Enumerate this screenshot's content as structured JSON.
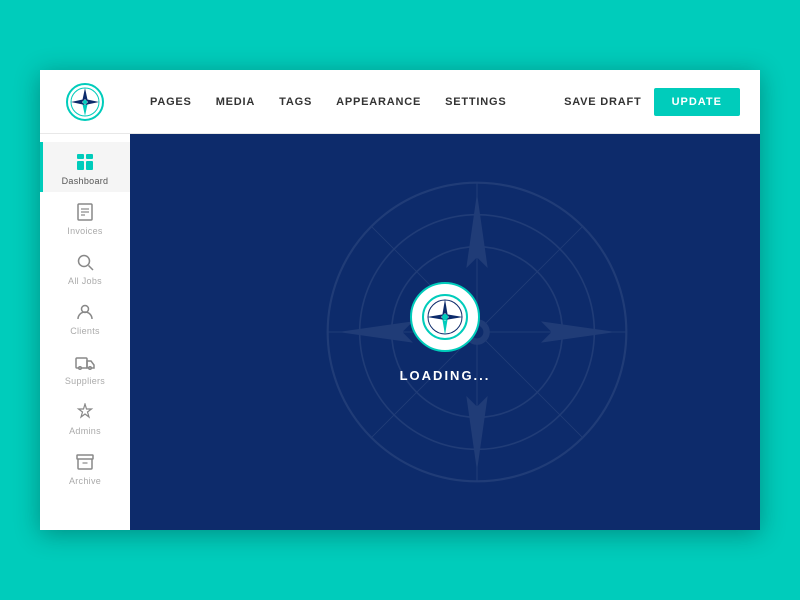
{
  "app": {
    "background_color": "#00CCBB"
  },
  "sidebar": {
    "items": [
      {
        "id": "dashboard",
        "label": "Dashboard",
        "icon": "grid",
        "active": true
      },
      {
        "id": "invoices",
        "label": "Invoices",
        "icon": "file",
        "active": false
      },
      {
        "id": "all-jobs",
        "label": "All Jobs",
        "icon": "search",
        "active": false
      },
      {
        "id": "clients",
        "label": "Clients",
        "icon": "person",
        "active": false
      },
      {
        "id": "suppliers",
        "label": "Suppliers",
        "icon": "truck",
        "active": false
      },
      {
        "id": "admins",
        "label": "Admins",
        "icon": "wrench",
        "active": false
      },
      {
        "id": "archive",
        "label": "Archive",
        "icon": "folder",
        "active": false
      }
    ]
  },
  "topnav": {
    "items": [
      {
        "id": "pages",
        "label": "PAGES"
      },
      {
        "id": "media",
        "label": "MEDIA"
      },
      {
        "id": "tags",
        "label": "TAGS"
      },
      {
        "id": "appearance",
        "label": "APPEARANCE"
      },
      {
        "id": "settings",
        "label": "SETTINGS"
      }
    ],
    "save_draft_label": "SAVE DRAFT",
    "update_label": "UPDATE"
  },
  "content": {
    "loading_text": "LOADING..."
  }
}
